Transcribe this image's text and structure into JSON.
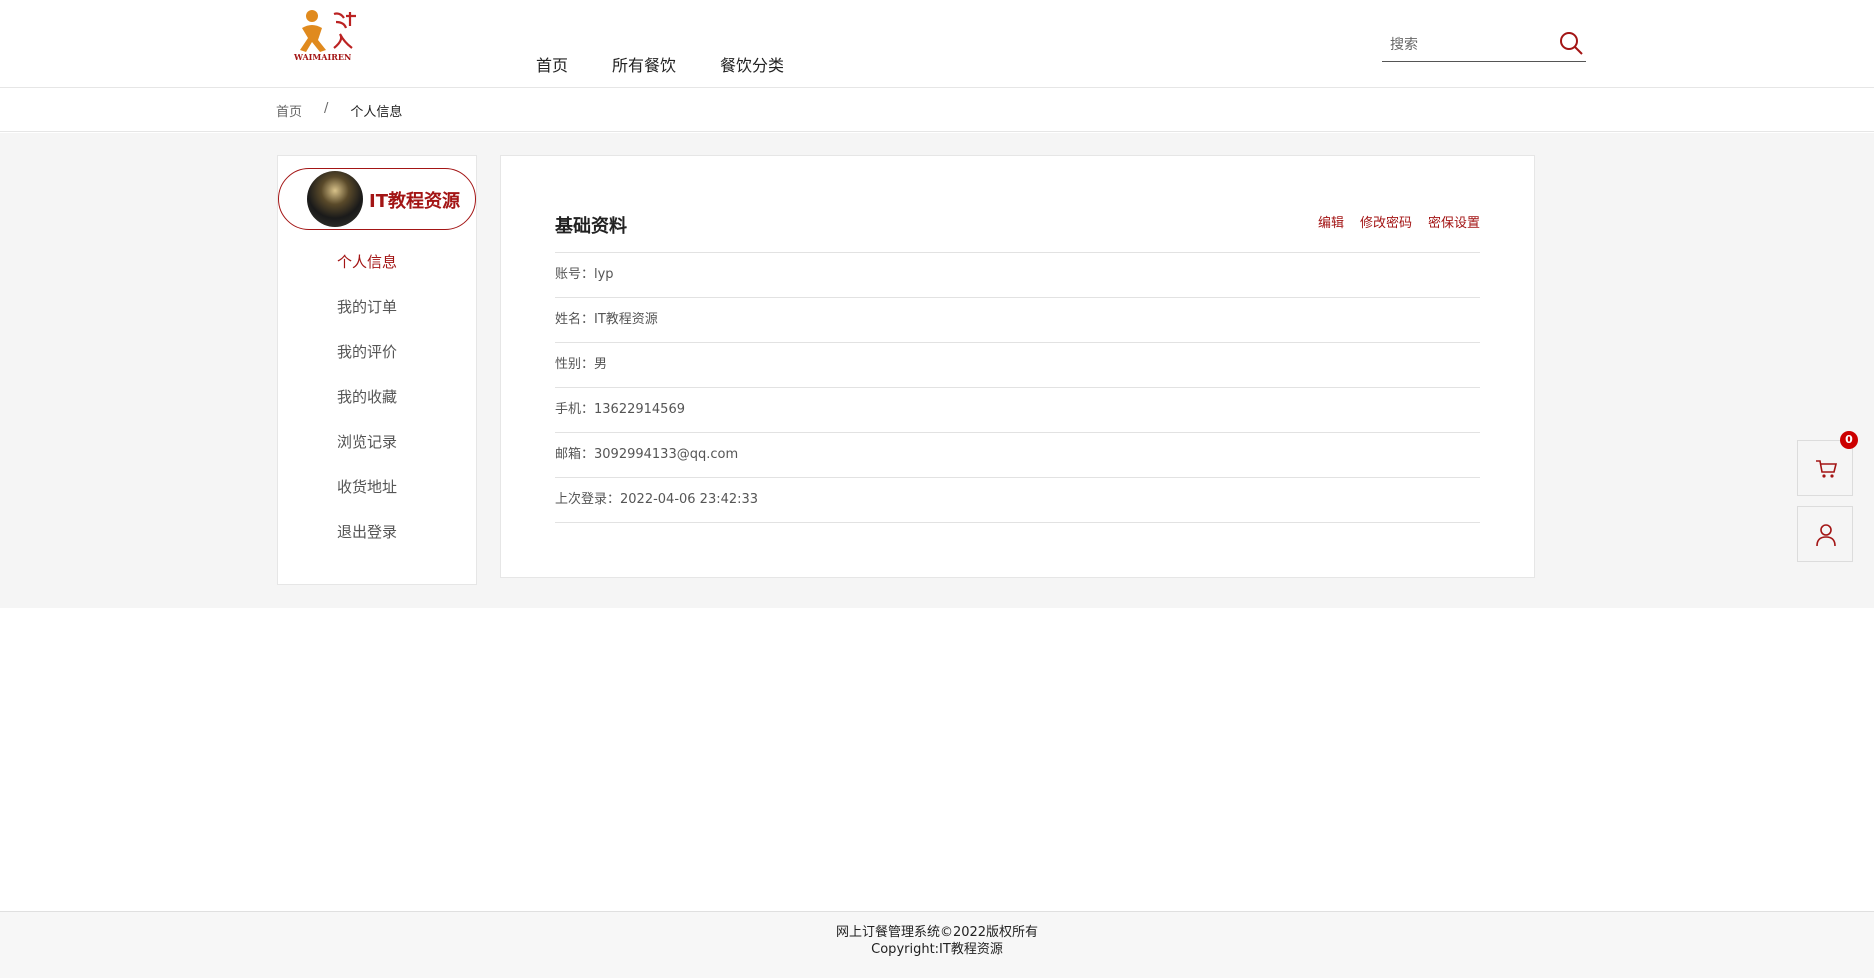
{
  "header": {
    "logo_text": "WAIMAIREN",
    "nav": [
      "首页",
      "所有餐饮",
      "餐饮分类"
    ],
    "search_placeholder": "搜索"
  },
  "breadcrumb": {
    "home": "首页",
    "separator": "/",
    "current": "个人信息"
  },
  "sidebar": {
    "user_name": "IT教程资源",
    "items": [
      "个人信息",
      "我的订单",
      "我的评价",
      "我的收藏",
      "浏览记录",
      "收货地址",
      "退出登录"
    ],
    "active_index": 0
  },
  "profile": {
    "title": "基础资料",
    "actions": {
      "edit": "编辑",
      "change_password": "修改密码",
      "security": "密保设置"
    },
    "rows": [
      "账号：lyp",
      "姓名：IT教程资源",
      "性别：男",
      "手机：13622914569",
      "邮箱：3092994133@qq.com",
      "上次登录：2022-04-06 23:42:33"
    ]
  },
  "cart": {
    "count": "0"
  },
  "colors": {
    "accent": "#a31515",
    "badge": "#cc0000"
  },
  "icons": [
    "search-icon",
    "cart-icon",
    "user-icon",
    "logo-icon"
  ],
  "footer": {
    "line1": "网上订餐管理系统©2022版权所有",
    "line2": "Copyright:IT教程资源"
  }
}
